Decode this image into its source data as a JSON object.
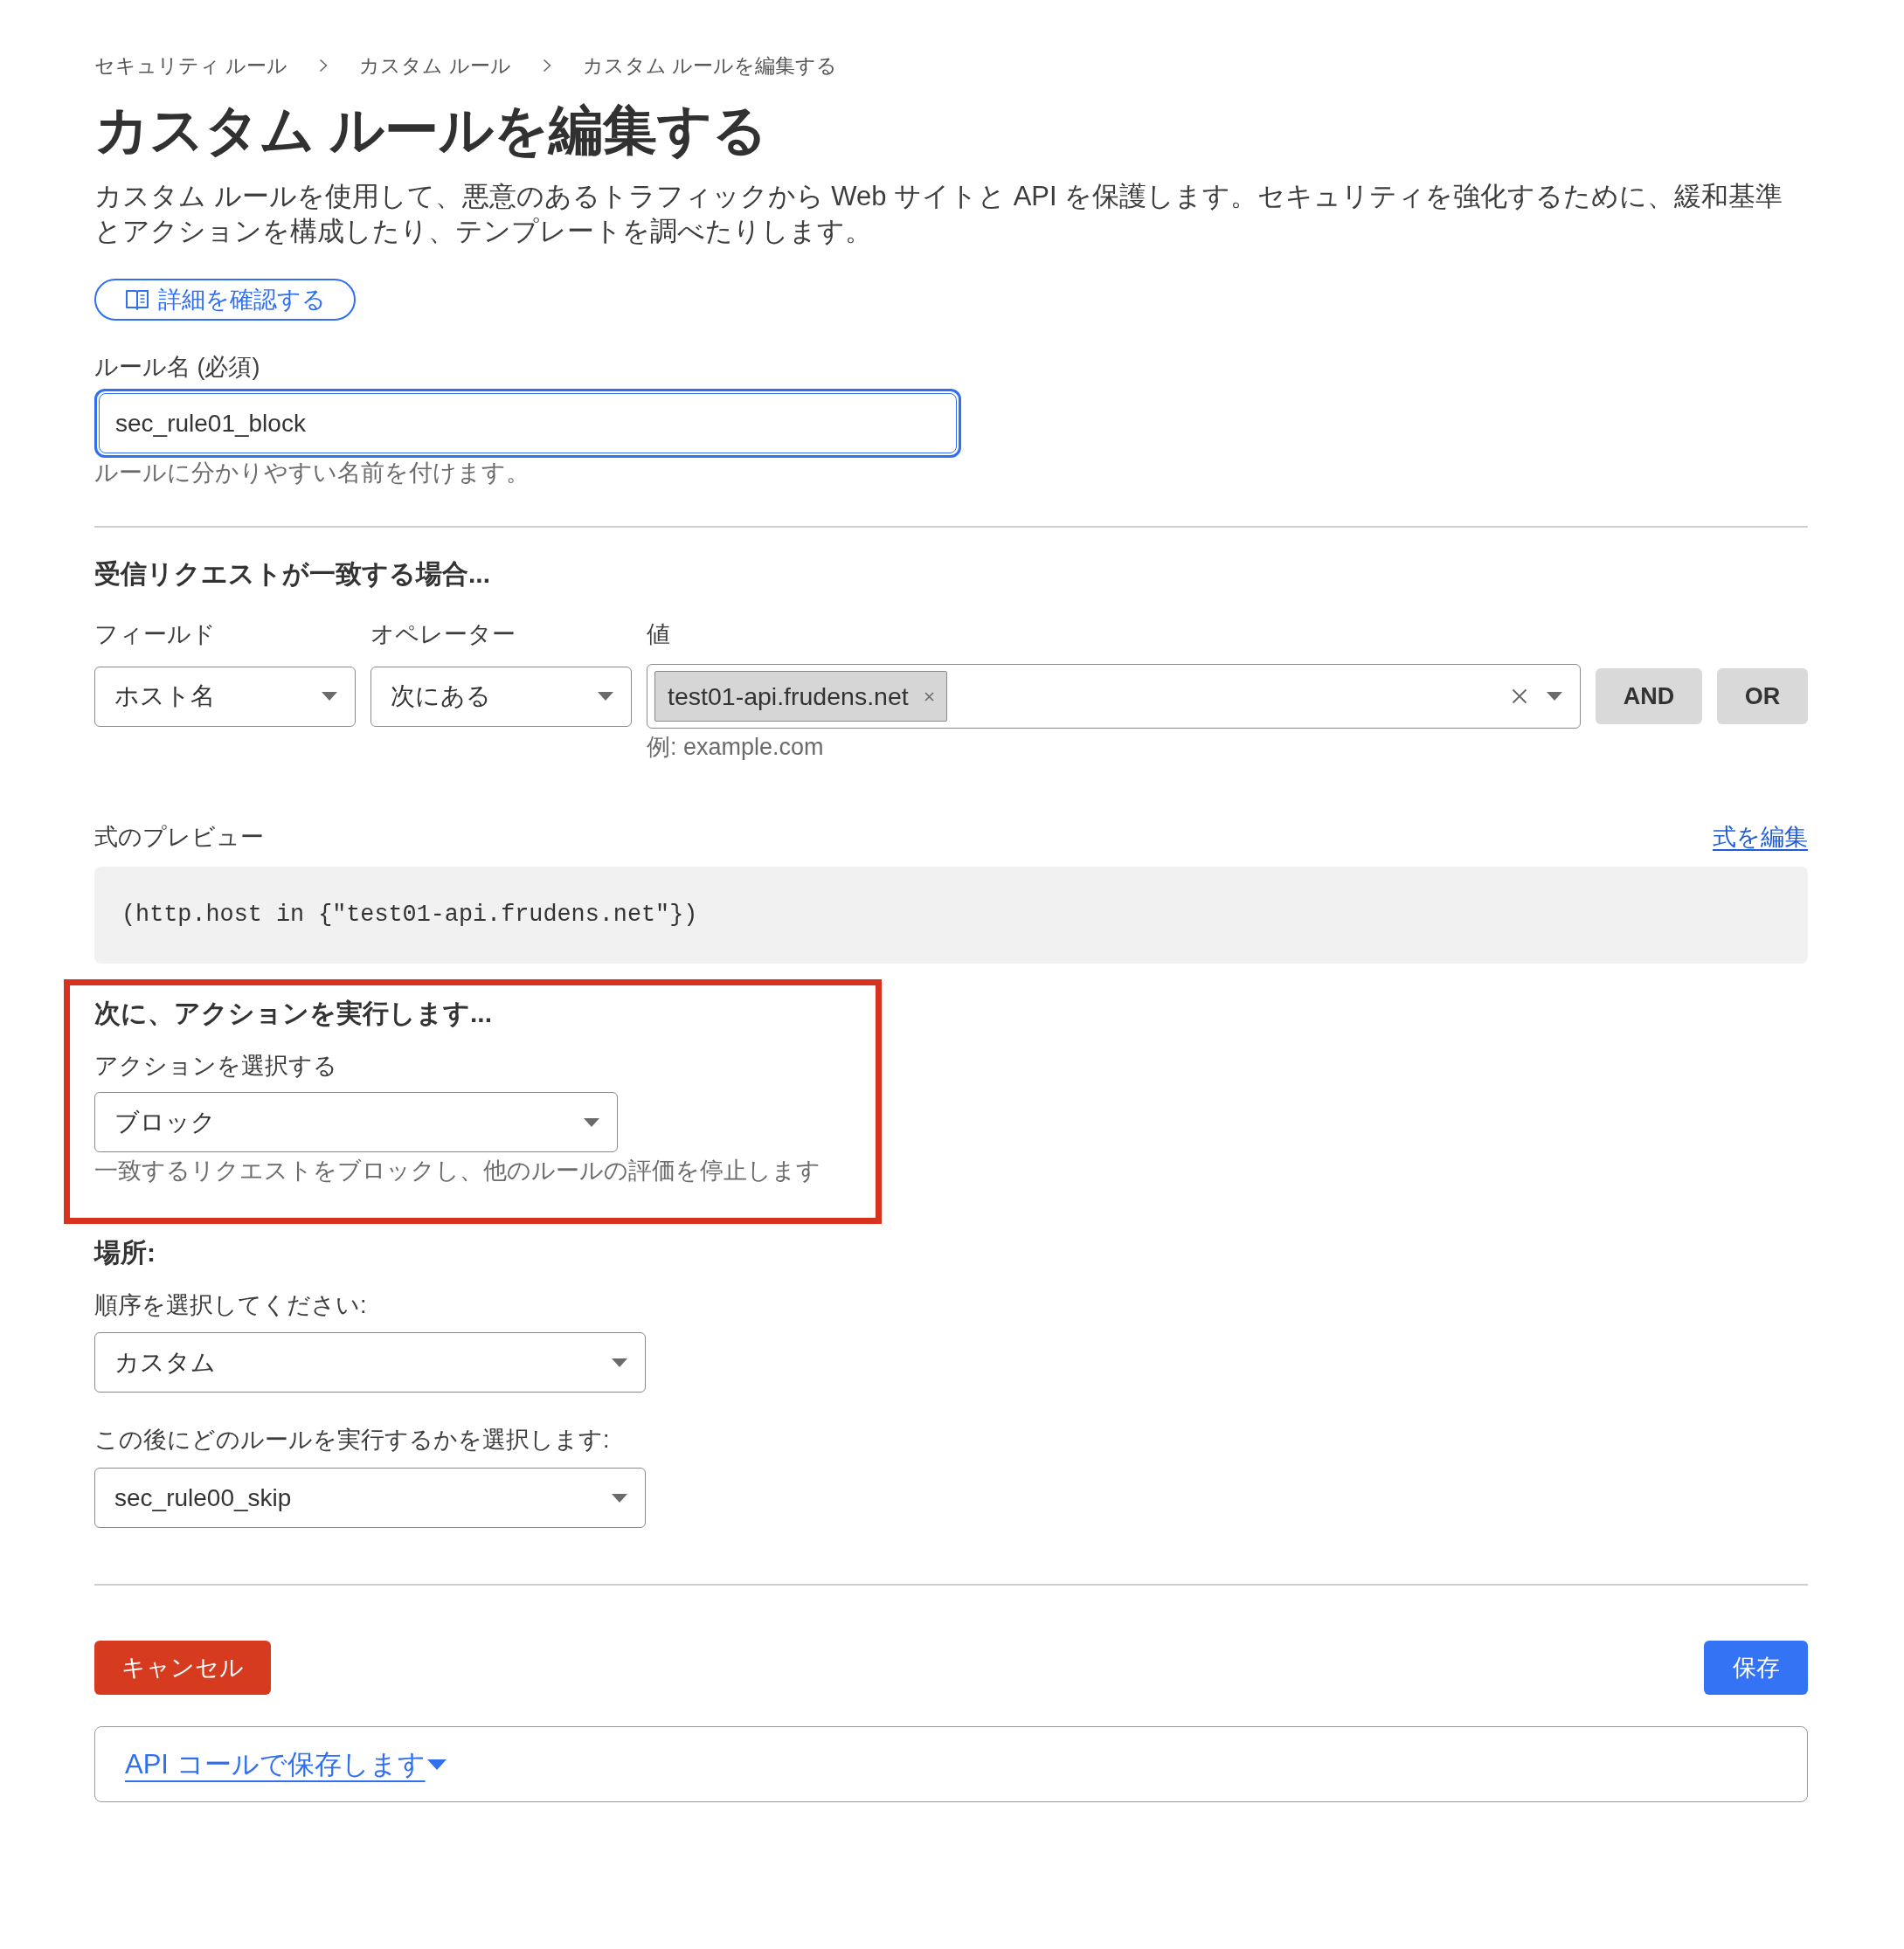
{
  "breadcrumbs": [
    {
      "label": "セキュリティ ルール"
    },
    {
      "label": "カスタム ルール"
    },
    {
      "label": "カスタム ルールを編集する"
    }
  ],
  "title": "カスタム ルールを編集する",
  "description": "カスタム ルールを使用して、悪意のあるトラフィックから Web サイトと API を保護します。セキュリティを強化するために、緩和基準とアクションを構成したり、テンプレートを調べたりします。",
  "learn_more_button": {
    "label": "詳細を確認する"
  },
  "rule_name": {
    "label": "ルール名 (必須)",
    "value": "sec_rule01_block",
    "focused": true,
    "help": "ルールに分かりやすい名前を付けます。"
  },
  "match_section": {
    "heading": "受信リクエストが一致する場合...",
    "field": {
      "label": "フィールド",
      "value": "ホスト名"
    },
    "operator": {
      "label": "オペレーター",
      "value": "次にある"
    },
    "value": {
      "label": "値",
      "tags": [
        "test01-api.frudens.net"
      ],
      "hint": "例: example.com"
    },
    "logic_buttons": [
      "AND",
      "OR"
    ]
  },
  "expression_preview": {
    "label": "式のプレビュー",
    "edit_link": "式を編集",
    "expression": "(http.host in {\"test01-api.frudens.net\"})"
  },
  "action_section": {
    "highlighted": true,
    "heading": "次に、アクションを実行します...",
    "select": {
      "label": "アクションを選択する",
      "value": "ブロック"
    },
    "help": "一致するリクエストをブロックし、他のルールの評価を停止します"
  },
  "placement": {
    "heading": "場所:",
    "order": {
      "label": "順序を選択してください:",
      "value": "カスタム"
    },
    "after_rule": {
      "label": "この後にどのルールを実行するかを選択します:",
      "value": "sec_rule00_skip"
    }
  },
  "footer": {
    "cancel_button": "キャンセル",
    "save_button": "保存",
    "api_link": "API コールで保存します"
  }
}
